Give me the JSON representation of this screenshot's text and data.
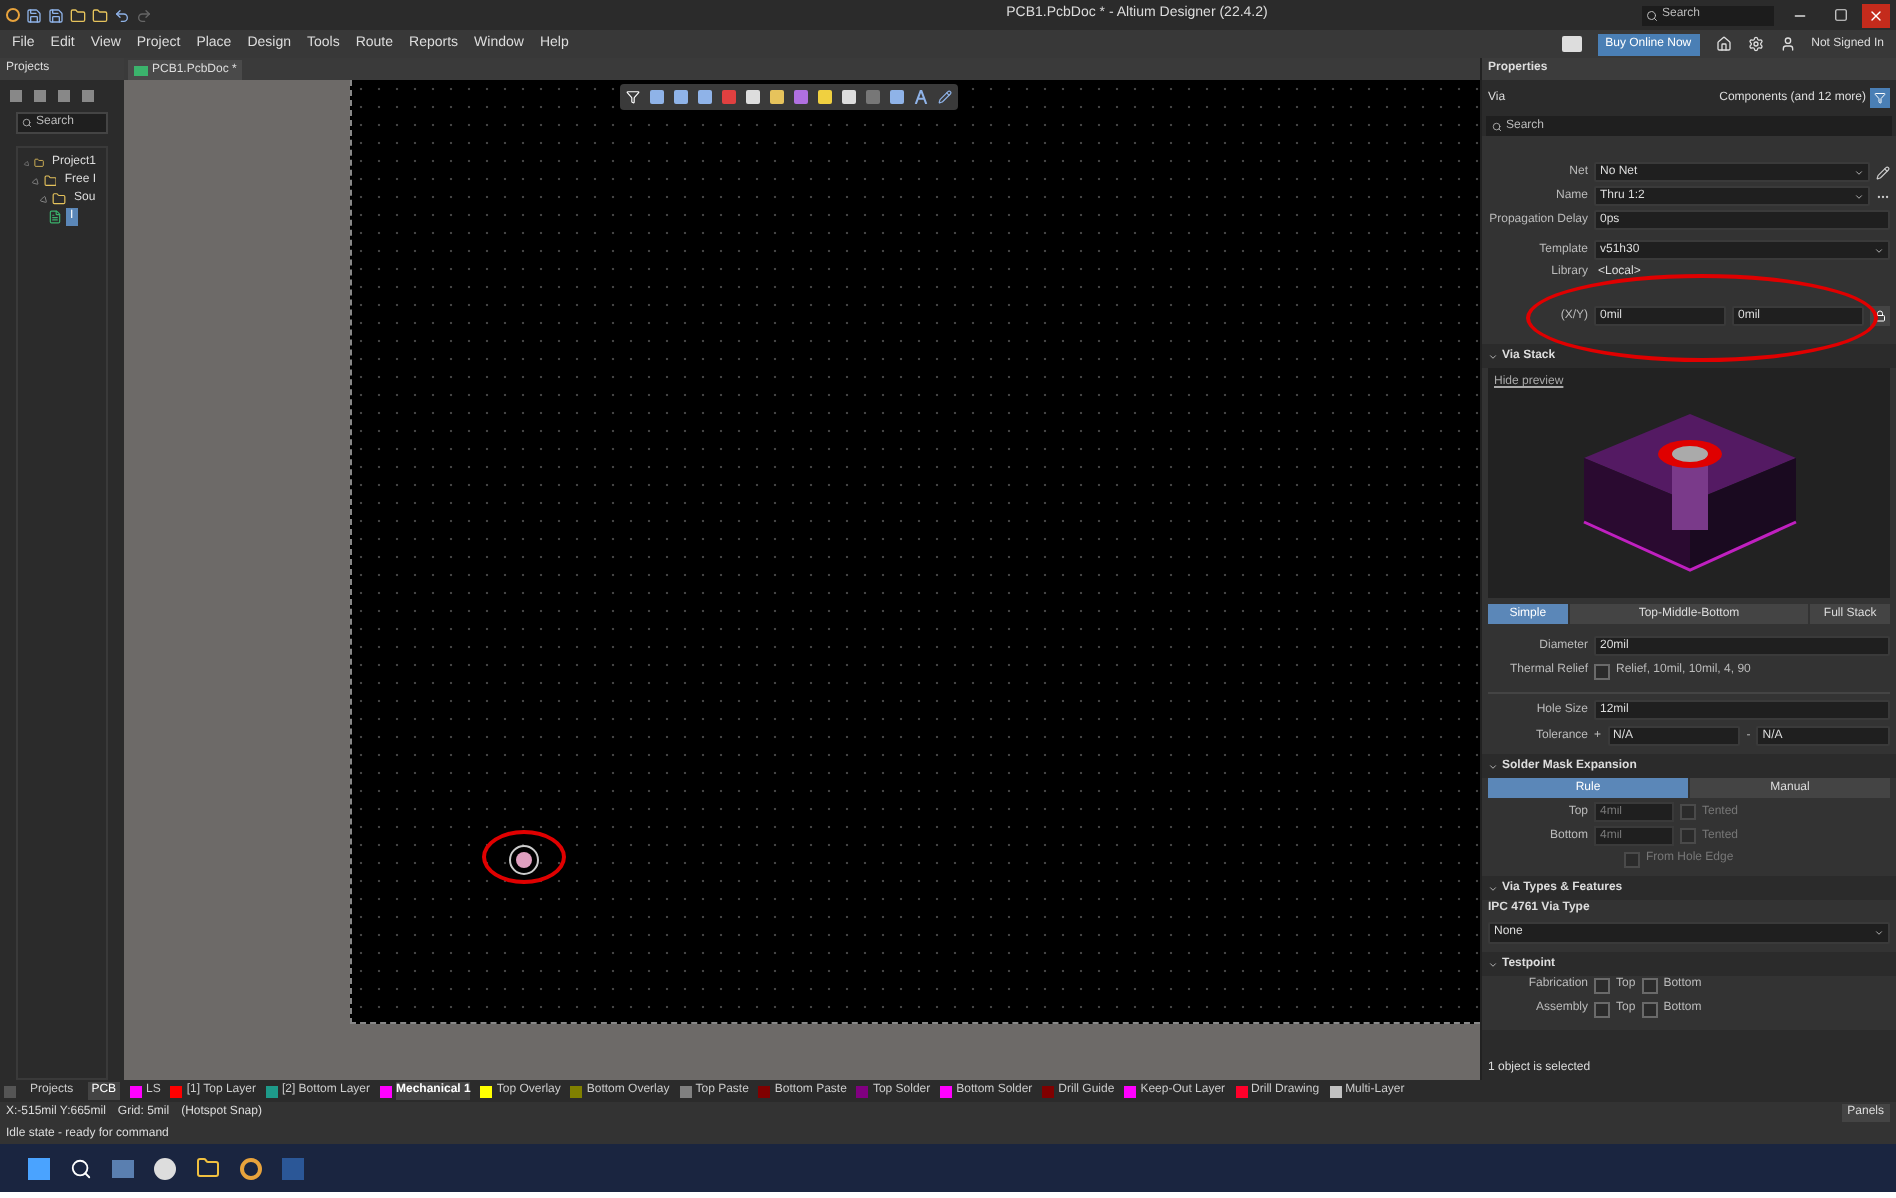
{
  "window": {
    "title": "PCB1.PcbDoc * - Altium Designer (22.4.2)",
    "search_placeholder": "Search"
  },
  "menu": [
    "File",
    "Edit",
    "View",
    "Project",
    "Place",
    "Design",
    "Tools",
    "Route",
    "Reports",
    "Window",
    "Help"
  ],
  "top_right": {
    "buy": "Buy Online Now",
    "account": "Not Signed In"
  },
  "projects_panel": {
    "title": "Projects",
    "search_placeholder": "Search",
    "tree": [
      {
        "label": "Project1",
        "selected": false,
        "children": [
          {
            "label": "Free I",
            "selected": false,
            "children": [
              {
                "label": "Sou",
                "selected": false,
                "children": [
                  {
                    "label": "I",
                    "selected": true
                  }
                ]
              }
            ]
          }
        ]
      }
    ]
  },
  "doc_tab": {
    "label": "PCB1.PcbDoc *"
  },
  "properties": {
    "title": "Properties",
    "object": "Via",
    "filter": "Components (and 12 more)",
    "search_placeholder": "Search",
    "fields": [
      {
        "kind": "dropdown",
        "label": "Net",
        "value": "No Net"
      },
      {
        "kind": "dropdown",
        "label": "Name",
        "value": "Thru 1:2"
      },
      {
        "kind": "text",
        "label": "Propagation Delay",
        "value": "0ps"
      },
      {
        "kind": "dropdown",
        "label": "Template",
        "value": "v51h30"
      },
      {
        "kind": "plain",
        "label": "Library",
        "value": "<Local>"
      }
    ],
    "xy": {
      "label": "(X/Y)",
      "x": "0mil",
      "y": "0mil"
    },
    "via_stack": {
      "title": "Via Stack",
      "hide_preview": "Hide preview",
      "modes": [
        {
          "label": "Simple",
          "selected": true
        },
        {
          "label": "Top-Middle-Bottom",
          "selected": false
        },
        {
          "label": "Full Stack",
          "selected": false
        }
      ],
      "diameter": {
        "label": "Diameter",
        "value": "20mil"
      },
      "thermal": {
        "label": "Thermal Relief",
        "checked": false,
        "value": "Relief, 10mil, 10mil, 4, 90"
      },
      "hole": {
        "label": "Hole Size",
        "value": "12mil"
      },
      "tolerance": {
        "label": "Tolerance",
        "plus": "+",
        "plus_value": "N/A",
        "minus": "-",
        "minus_value": "N/A"
      }
    },
    "solder_mask": {
      "title": "Solder Mask Expansion",
      "modes": [
        {
          "label": "Rule",
          "selected": true
        },
        {
          "label": "Manual",
          "selected": false
        }
      ],
      "rows": [
        {
          "label": "Top",
          "placeholder": "4mil",
          "tented": "Tented",
          "checked": false
        },
        {
          "label": "Bottom",
          "placeholder": "4mil",
          "tented": "Tented",
          "checked": false
        }
      ],
      "from_hole": {
        "label": "From Hole Edge",
        "checked": false
      }
    },
    "via_types": {
      "title": "Via Types & Features",
      "type_label": "IPC 4761 Via Type",
      "type_value": "None"
    },
    "testpoint": {
      "title": "Testpoint",
      "rows": [
        {
          "label": "Fabrication",
          "top": "Top",
          "top_checked": false,
          "bottom": "Bottom",
          "bottom_checked": false
        },
        {
          "label": "Assembly",
          "top": "Top",
          "top_checked": false,
          "bottom": "Bottom",
          "bottom_checked": false
        }
      ]
    },
    "footer": "1 object is selected"
  },
  "bottom_tabs": [
    {
      "label": "Projects",
      "selected": false
    },
    {
      "label": "PCB",
      "selected": true
    }
  ],
  "layers": [
    {
      "label": "LS",
      "color": "#ff00ff",
      "selected": false
    },
    {
      "label": "[1] Top Layer",
      "color": "#ff0000",
      "selected": false
    },
    {
      "label": "[2] Bottom Layer",
      "color": "#1e9a8a",
      "selected": false
    },
    {
      "label": "Mechanical 1",
      "color": "#ff00ff",
      "selected": true
    },
    {
      "label": "Top Overlay",
      "color": "#ffff00",
      "selected": false
    },
    {
      "label": "Bottom Overlay",
      "color": "#808000",
      "selected": false
    },
    {
      "label": "Top Paste",
      "color": "#808080",
      "selected": false
    },
    {
      "label": "Bottom Paste",
      "color": "#800000",
      "selected": false
    },
    {
      "label": "Top Solder",
      "color": "#800080",
      "selected": false
    },
    {
      "label": "Bottom Solder",
      "color": "#ff00ff",
      "selected": false
    },
    {
      "label": "Drill Guide",
      "color": "#800000",
      "selected": false
    },
    {
      "label": "Keep-Out Layer",
      "color": "#ff00ff",
      "selected": false
    },
    {
      "label": "Drill Drawing",
      "color": "#ff002a",
      "selected": false
    },
    {
      "label": "Multi-Layer",
      "color": "#c0c0c0",
      "selected": false
    }
  ],
  "status": {
    "coords": "X:-515mil Y:665mil",
    "grid": "Grid: 5mil",
    "snap": "(Hotspot Snap)",
    "state": "Idle state - ready for command",
    "panels": "Panels"
  }
}
